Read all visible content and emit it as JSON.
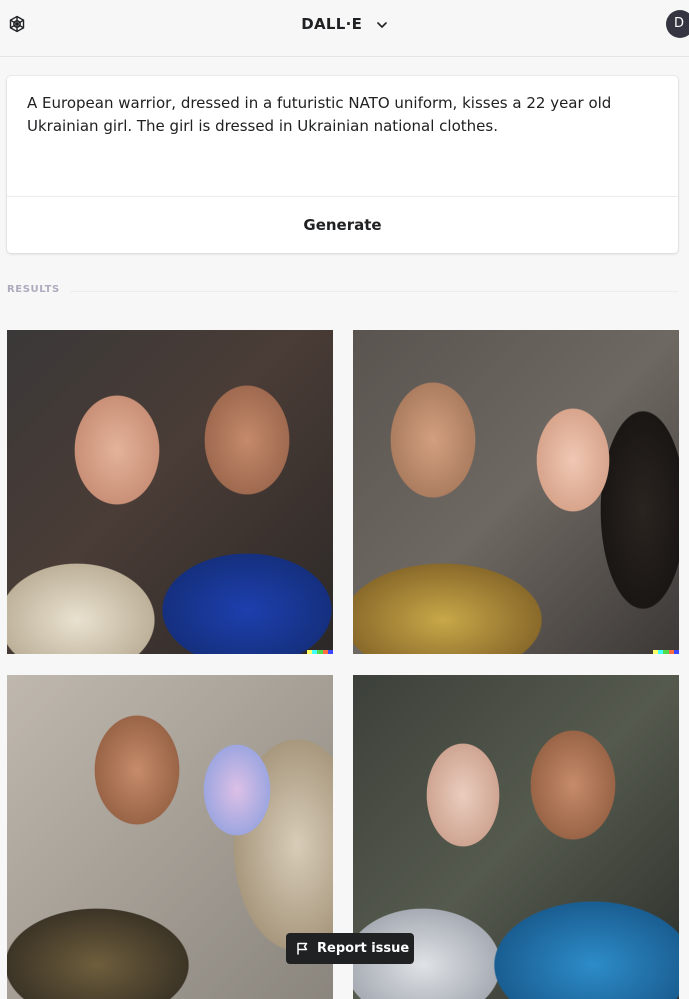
{
  "header": {
    "app_title": "DALL·E",
    "avatar_initial": "D",
    "icons": {
      "logo": "openai-logo-icon",
      "title_menu": "chevron-down-icon"
    }
  },
  "prompt": {
    "text": "A European warrior, dressed in a futuristic NATO uniform, kisses a 22 year old Ukrainian girl. The girl is dressed in Ukrainian national clothes.",
    "generate_label": "Generate"
  },
  "results": {
    "label": "RESULTS",
    "images": [
      {
        "subject": "generated-image",
        "signature": true
      },
      {
        "subject": "generated-image",
        "signature": true
      },
      {
        "subject": "generated-image",
        "signature": false
      },
      {
        "subject": "generated-image",
        "signature": false
      }
    ]
  },
  "report": {
    "label": "Report issue",
    "icon": "flag-icon"
  },
  "colors": {
    "background": "#f7f7f8",
    "card": "#ffffff",
    "text": "#202123",
    "muted": "#acacbe",
    "dark_button": "#202123",
    "signature": [
      "#ffff66",
      "#42ffff",
      "#51da4c",
      "#ff6e3c",
      "#3c46ff"
    ]
  }
}
